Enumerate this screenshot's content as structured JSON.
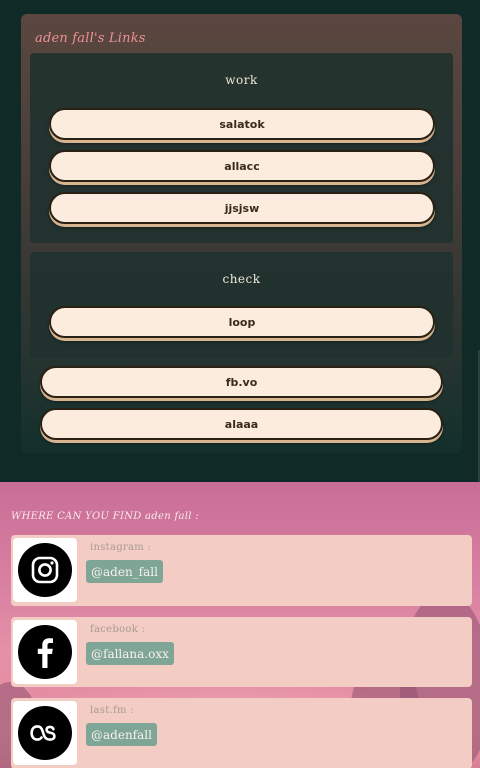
{
  "links": {
    "title": "aden fall's Links",
    "groups": [
      {
        "title": "work",
        "items": [
          "salatok",
          "allacc",
          "jjsjsw"
        ]
      },
      {
        "title": "check",
        "items": [
          "loop"
        ]
      }
    ],
    "loose_items": [
      "fb.vo",
      "alaaa"
    ]
  },
  "find": {
    "title": "WHERE CAN YOU FIND aden fall :",
    "cards": [
      {
        "platform": "instagram :",
        "handle": "@aden_fall",
        "icon": "instagram-icon"
      },
      {
        "platform": "facebook :",
        "handle": "@fallana.oxx",
        "icon": "facebook-icon"
      },
      {
        "platform": "last.fm :",
        "handle": "@adenfall",
        "icon": "lastfm-icon"
      }
    ]
  },
  "colors": {
    "page_bg": "#0f2a27",
    "title_pink": "#f08f93",
    "pill_bg": "#fcecde",
    "handle_bg": "#7fa596",
    "card_bg": "#f3ccc3"
  }
}
